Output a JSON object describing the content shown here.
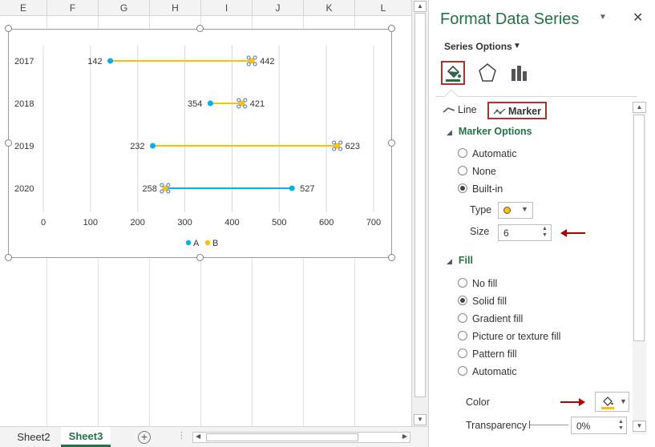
{
  "spreadsheet": {
    "columns": [
      "E",
      "F",
      "G",
      "H",
      "I",
      "J",
      "K",
      "L"
    ],
    "tabs": [
      "Sheet2",
      "Sheet3"
    ],
    "active_tab": "Sheet3"
  },
  "chart_data": {
    "type": "dumbbell",
    "categories": [
      "2017",
      "2018",
      "2019",
      "2020"
    ],
    "series": [
      {
        "name": "A",
        "color": "#00b0f0",
        "values": [
          142,
          354,
          232,
          527
        ]
      },
      {
        "name": "B",
        "color": "#ffc000",
        "values": [
          442,
          421,
          623,
          258
        ]
      }
    ],
    "connector_colors": [
      "#ffc000",
      "#ffc000",
      "#ffc000",
      "#00b0f0"
    ],
    "x_ticks": [
      0,
      100,
      200,
      300,
      400,
      500,
      600,
      700
    ],
    "xlim": [
      0,
      700
    ],
    "grid": "vertical",
    "legend": "bottom",
    "selected_series": "B"
  },
  "pane": {
    "title": "Format Data Series",
    "series_options": "Series Options",
    "subtabs": {
      "line": "Line",
      "marker": "Marker"
    },
    "marker_options": {
      "heading": "Marker Options",
      "options": [
        "Automatic",
        "None",
        "Built-in"
      ],
      "selected": "Built-in",
      "type_label": "Type",
      "size_label": "Size",
      "size_value": "6"
    },
    "fill": {
      "heading": "Fill",
      "options": [
        "No fill",
        "Solid fill",
        "Gradient fill",
        "Picture or texture fill",
        "Pattern fill",
        "Automatic"
      ],
      "selected": "Solid fill",
      "color_label": "Color",
      "transparency_label": "Transparency",
      "transparency_value": "0%"
    },
    "accent": "#217346",
    "highlight": "#b03030"
  }
}
